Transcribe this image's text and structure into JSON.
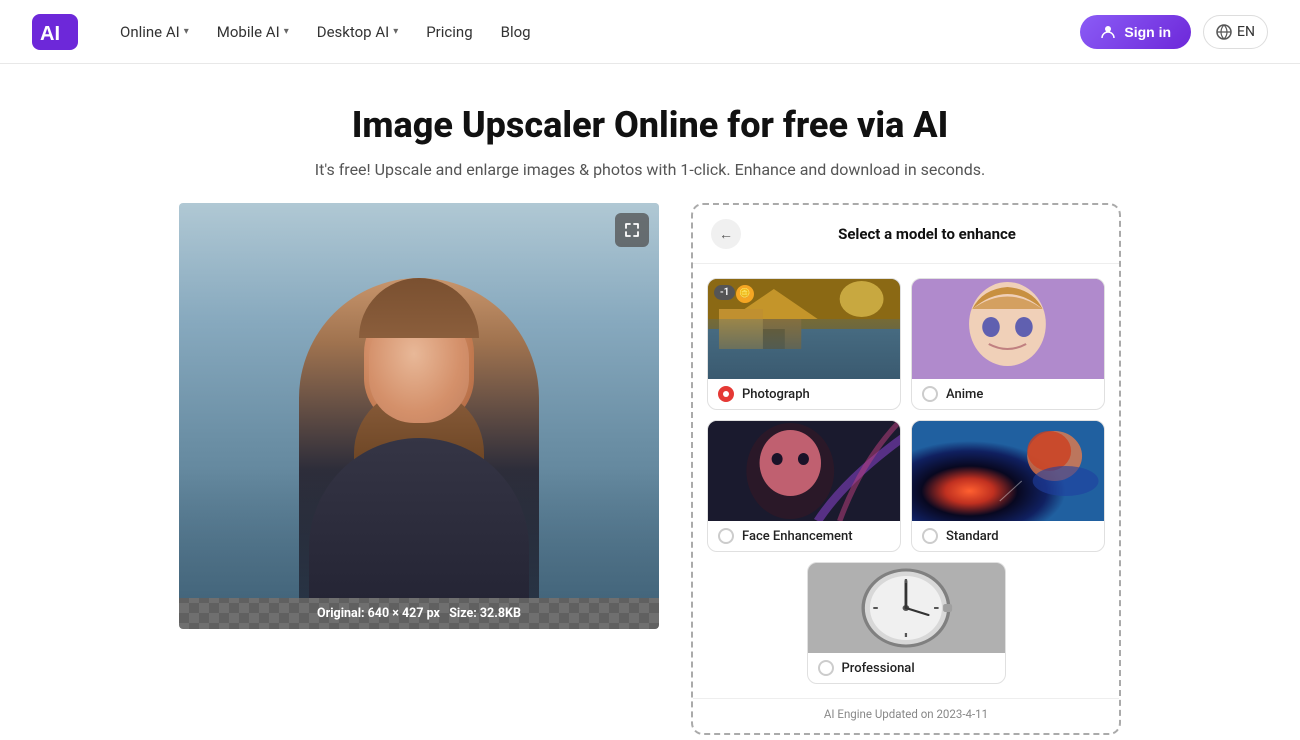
{
  "navbar": {
    "logo_alt": "AI Logo",
    "nav_items": [
      {
        "label": "Online AI",
        "has_dropdown": true
      },
      {
        "label": "Mobile AI",
        "has_dropdown": true
      },
      {
        "label": "Desktop AI",
        "has_dropdown": true
      },
      {
        "label": "Pricing",
        "has_dropdown": false
      },
      {
        "label": "Blog",
        "has_dropdown": false
      }
    ],
    "sign_in": "Sign in",
    "lang": "EN"
  },
  "hero": {
    "title": "Image Upscaler Online for free via AI",
    "subtitle": "It's free! Upscale and enlarge images & photos with 1-click. Enhance and download in seconds."
  },
  "image_panel": {
    "info": "Original: 640 × 427 px",
    "size": "Size: 32.8KB"
  },
  "model_selector": {
    "header": "Select a model to enhance",
    "back_label": "←",
    "models": [
      {
        "id": "photograph",
        "label": "Photograph",
        "selected": true,
        "badge": "-1",
        "has_coin": true
      },
      {
        "id": "anime",
        "label": "Anime",
        "selected": false
      },
      {
        "id": "face-enhancement",
        "label": "Face Enhancement",
        "selected": false
      },
      {
        "id": "standard",
        "label": "Standard",
        "selected": false
      },
      {
        "id": "professional",
        "label": "Professional",
        "selected": false
      }
    ],
    "footer": "AI Engine Updated on 2023-4-11"
  }
}
